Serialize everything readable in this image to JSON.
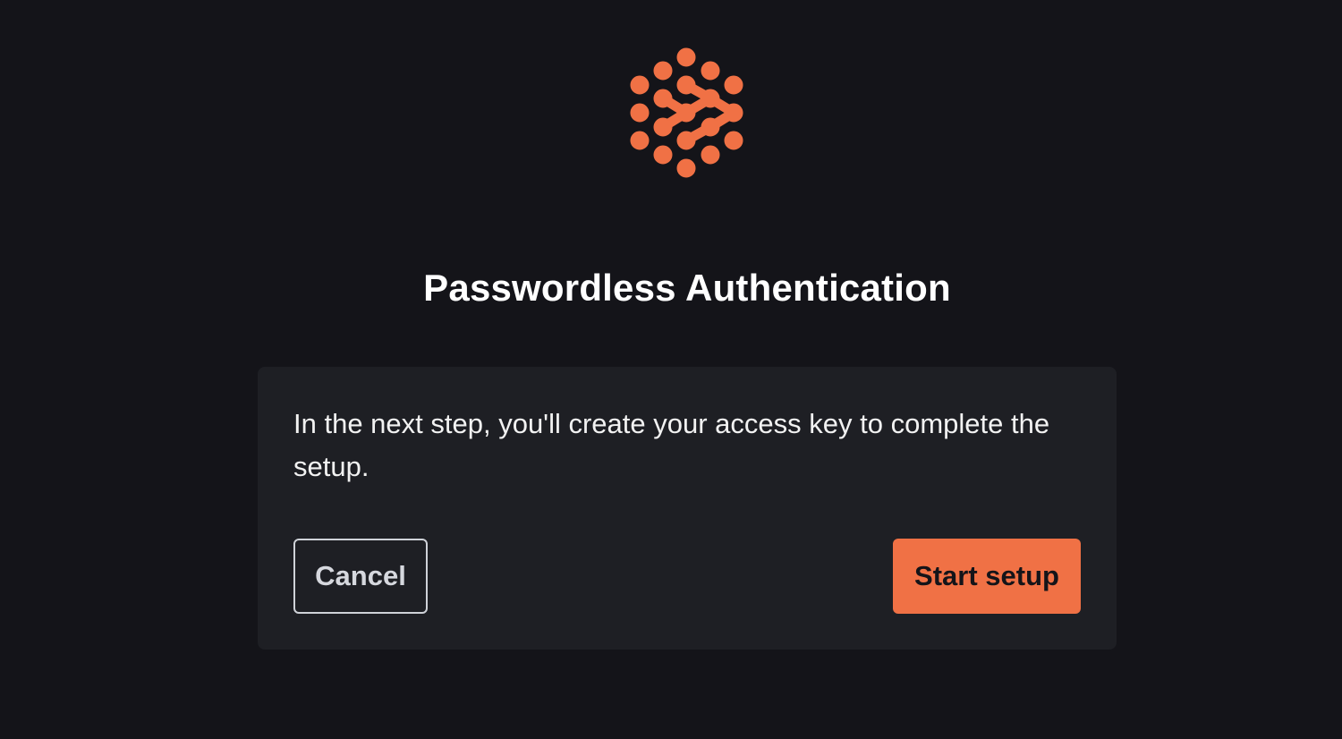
{
  "colors": {
    "page_background": "#141419",
    "card_background": "#1e1f24",
    "accent": "#f07145",
    "title_text": "#ffffff",
    "body_text": "#f2f2f2",
    "cancel_border": "#cfd2d8"
  },
  "logo": {
    "icon": "dotted-network-logo-icon"
  },
  "header": {
    "title": "Passwordless Authentication"
  },
  "card": {
    "message": "In the next step, you'll create your access key to complete the setup.",
    "cancel_label": "Cancel",
    "start_label": "Start setup"
  }
}
